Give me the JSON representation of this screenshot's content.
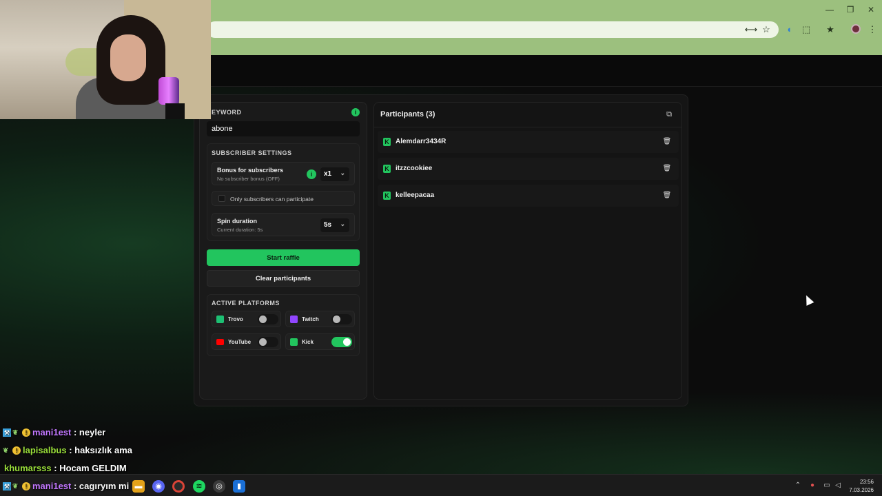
{
  "browser": {
    "window_controls": [
      "—",
      "❐",
      "✕"
    ],
    "toolbar_icons": [
      "translate-icon",
      "star-icon",
      "media-icon",
      "extensions-icon",
      "bookmarks-icon",
      "profile-avatar",
      "menu-icon"
    ]
  },
  "raffle": {
    "keyword_label": "EYWORD",
    "keyword_value": "abone",
    "subscriber_settings_label": "SUBSCRIBER SETTINGS",
    "bonus_title": "Bonus for subscribers",
    "bonus_sub": "No subscriber bonus (OFF)",
    "bonus_value": "x1",
    "only_subs_label": "Only subscribers can participate",
    "only_subs_checked": false,
    "spin_title": "Spin duration",
    "spin_sub": "Current duration: 5s",
    "spin_value": "5s",
    "start_button": "Start raffle",
    "clear_button": "Clear participants",
    "platforms_label": "ACTIVE PLATFORMS",
    "platforms": [
      {
        "name": "Trovo",
        "enabled": false,
        "color": "#1dbf73"
      },
      {
        "name": "Twitch",
        "enabled": false,
        "color": "#9146ff"
      },
      {
        "name": "YouTube",
        "enabled": false,
        "color": "#ff0000"
      },
      {
        "name": "Kick",
        "enabled": true,
        "color": "#53fc18"
      }
    ]
  },
  "participants": {
    "title": "Participants (3)",
    "items": [
      {
        "name": "Alemdarr3434R",
        "platform": "kick"
      },
      {
        "name": "itzzcookiee",
        "platform": "kick"
      },
      {
        "name": "kelleepacaa",
        "platform": "kick"
      }
    ]
  },
  "chat": [
    {
      "user": "mani1est",
      "message": " : neyler"
    },
    {
      "user": "lapisalbus",
      "message": " : haksızlık ama"
    },
    {
      "user": "khumarsss",
      "message": " : Hocam GELDIM"
    },
    {
      "user": "mani1est",
      "message": " : cagıryım mi"
    }
  ],
  "taskbar": {
    "time": "23:56",
    "date": "7.03.2026"
  },
  "colors": {
    "accent": "#22c55e",
    "chrome": "#9cc07e",
    "background": "#0d0d0d"
  }
}
